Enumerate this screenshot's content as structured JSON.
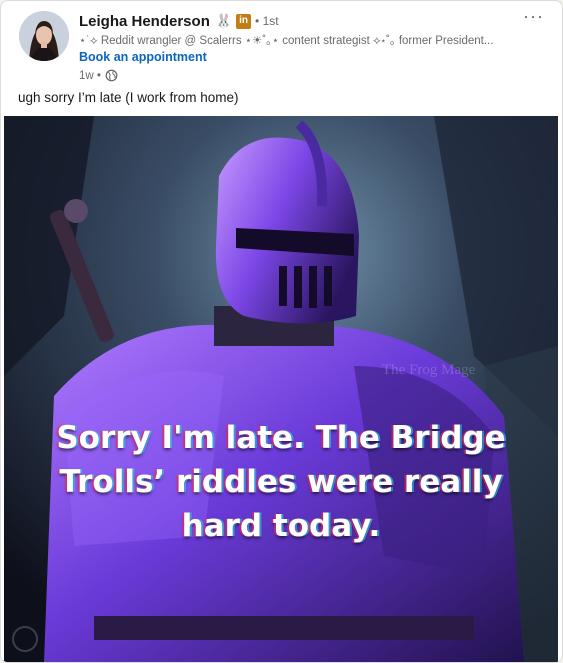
{
  "post": {
    "author": {
      "name": "Leigha Henderson",
      "name_emoji": "🐰",
      "badge": "in",
      "degree": "• 1st",
      "headline": "⋆˙⟡ Reddit wrangler @ Scalerrs ⋆☀︎˚｡⋆ content strategist ⟡⋆˚｡ former President...",
      "cta": "Book an appointment",
      "time": "1w •"
    },
    "more_menu": "···",
    "text": "ugh sorry I’m late (I work from home)",
    "image": {
      "caption_lines": [
        "Sorry I'm late. The Bridge",
        "Trolls’ riddles were really",
        "hard today."
      ],
      "watermark": "The Frog Mage"
    }
  },
  "colors": {
    "link": "#0a66c2",
    "badge": "#c37d16"
  }
}
